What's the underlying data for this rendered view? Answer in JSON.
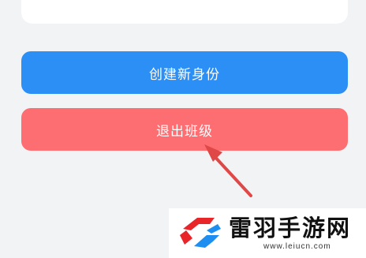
{
  "buttons": {
    "create_identity": "创建新身份",
    "exit_class": "退出班级"
  },
  "watermark": {
    "name": "雷羽手游网",
    "url": "www.leiucn.com"
  },
  "colors": {
    "primary": "#2b8ff5",
    "danger": "#fd6e72",
    "annotation_arrow": "#e04848",
    "logo_red": "#e8262a",
    "logo_blue": "#1e8ff0"
  },
  "icons": {
    "annotation": "arrow-annotation-icon",
    "logo": "leiyu-logo-icon"
  }
}
